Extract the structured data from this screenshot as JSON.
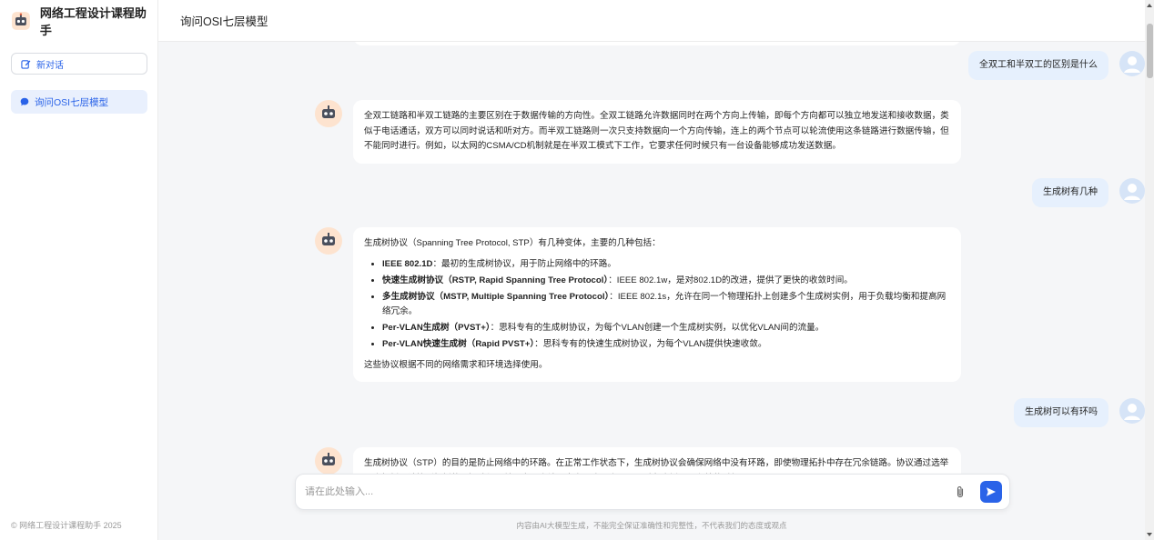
{
  "sidebar": {
    "brand_title": "网络工程设计课程助手",
    "new_chat_label": "新对话",
    "conversations": [
      {
        "label": "询问OSI七层模型"
      }
    ],
    "copyright": "© 网络工程设计课程助手 2025"
  },
  "header": {
    "title": "询问OSI七层模型"
  },
  "messages": [
    {
      "role": "user",
      "text": "全双工和半双工的区别是什么"
    },
    {
      "role": "assistant",
      "text": "全双工链路和半双工链路的主要区别在于数据传输的方向性。全双工链路允许数据同时在两个方向上传输，即每个方向都可以独立地发送和接收数据，类似于电话通话，双方可以同时说话和听对方。而半双工链路则一次只支持数据向一个方向传输，连上的两个节点可以轮流使用这条链路进行数据传输，但不能同时进行。例如，以太网的CSMA/CD机制就是在半双工模式下工作，它要求任何时候只有一台设备能够成功发送数据。"
    },
    {
      "role": "user",
      "text": "生成树有几种"
    },
    {
      "role": "assistant",
      "intro": "生成树协议（Spanning Tree Protocol, STP）有几种变体，主要的几种包括：",
      "items": [
        {
          "bold": "IEEE 802.1D",
          "rest": "：最初的生成树协议，用于防止网络中的环路。"
        },
        {
          "bold": "快速生成树协议（RSTP, Rapid Spanning Tree Protocol）",
          "rest": "：IEEE 802.1w，是对802.1D的改进，提供了更快的收敛时间。"
        },
        {
          "bold": "多生成树协议（MSTP, Multiple Spanning Tree Protocol）",
          "rest": "：IEEE 802.1s，允许在同一个物理拓扑上创建多个生成树实例，用于负载均衡和提高网络冗余。"
        },
        {
          "bold": "Per-VLAN生成树（PVST+）",
          "rest": "：思科专有的生成树协议，为每个VLAN创建一个生成树实例，以优化VLAN间的流量。"
        },
        {
          "bold": "Per-VLAN快速生成树（Rapid PVST+）",
          "rest": "：思科专有的快速生成树协议，为每个VLAN提供快速收敛。"
        }
      ],
      "outro": "这些协议根据不同的网络需求和环境选择使用。"
    },
    {
      "role": "user",
      "text": "生成树可以有环吗"
    },
    {
      "role": "assistant",
      "text": "生成树协议（STP）的目的是防止网络中的环路。在正常工作状态下，生成树协议会确保网络中没有环路，即使物理拓扑中存在冗余链路。协议通过选举一个根桥，计算到根桥的最短路径，并阻塞冗余端口来实现这一点，从而避免广播风暴和帧的重复。"
    }
  ],
  "input": {
    "placeholder": "请在此处输入..."
  },
  "footer": {
    "disclaimer": "内容由AI大模型生成，不能完全保证准确性和完整性，不代表我们的态度或观点"
  },
  "colors": {
    "accent": "#2a63e8",
    "user_bubble": "#e6f0fd",
    "background": "#f5f6f8"
  }
}
